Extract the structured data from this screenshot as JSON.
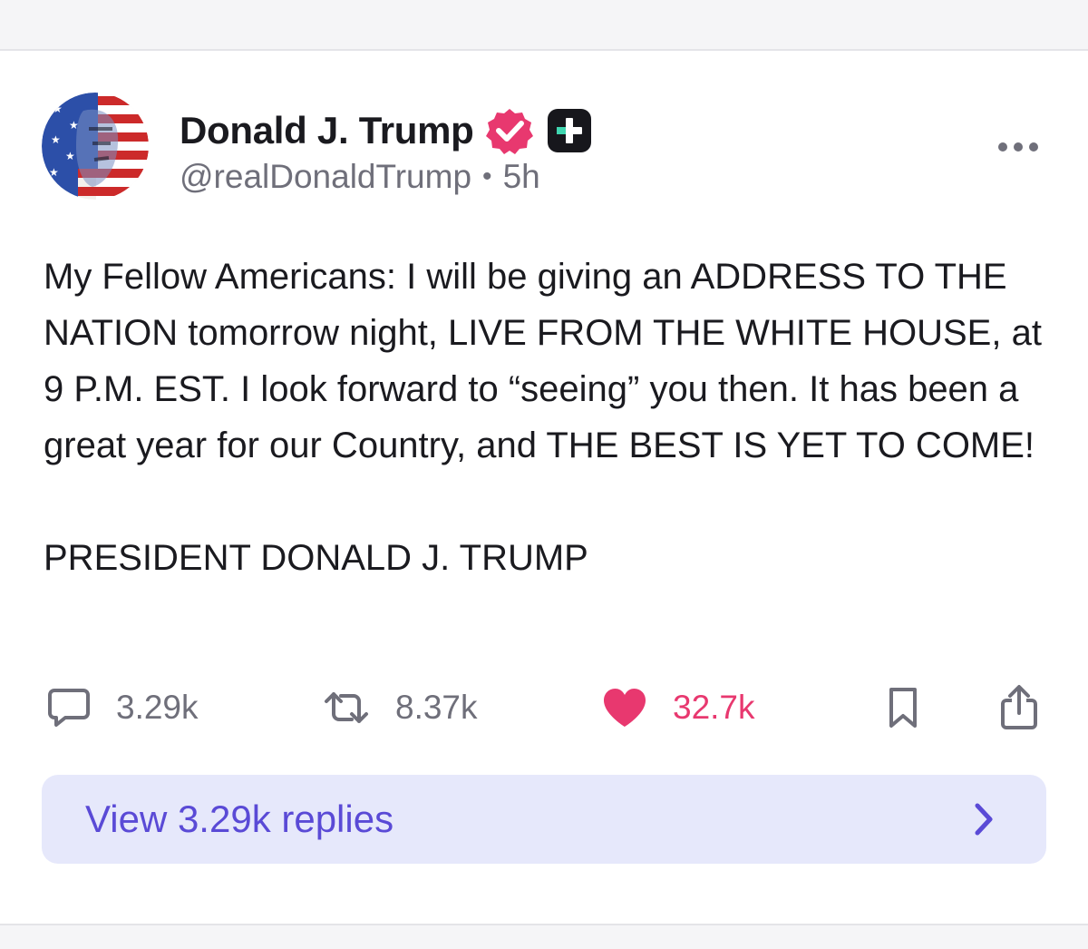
{
  "post": {
    "author": {
      "display_name": "Donald J. Trump",
      "handle": "@realDonaldTrump",
      "separator": "•",
      "time": "5h"
    },
    "body": [
      "My Fellow Americans: I will be giving an ADDRESS TO THE NATION tomorrow night, LIVE FROM THE WHITE HOUSE, at 9 P.M. EST. I look forward to “seeing” you then. It has been a great year for our Country, and THE BEST IS YET TO COME!",
      "PRESIDENT DONALD J. TRUMP"
    ],
    "stats": {
      "replies": "3.29k",
      "reposts": "8.37k",
      "likes": "32.7k"
    },
    "view_replies_label": "View 3.29k replies"
  },
  "icons": {
    "verified": "verified-badge-icon",
    "plus": "plus-badge-icon",
    "more": "more-icon",
    "reply": "comment-icon",
    "repost": "repost-icon",
    "like": "heart-icon",
    "bookmark": "bookmark-icon",
    "share": "share-icon",
    "chevron": "chevron-right-icon"
  },
  "colors": {
    "accent": "#5a4ad6",
    "like": "#e8386f",
    "verified": "#e8386f",
    "replies_bg": "#e6e8fb"
  }
}
